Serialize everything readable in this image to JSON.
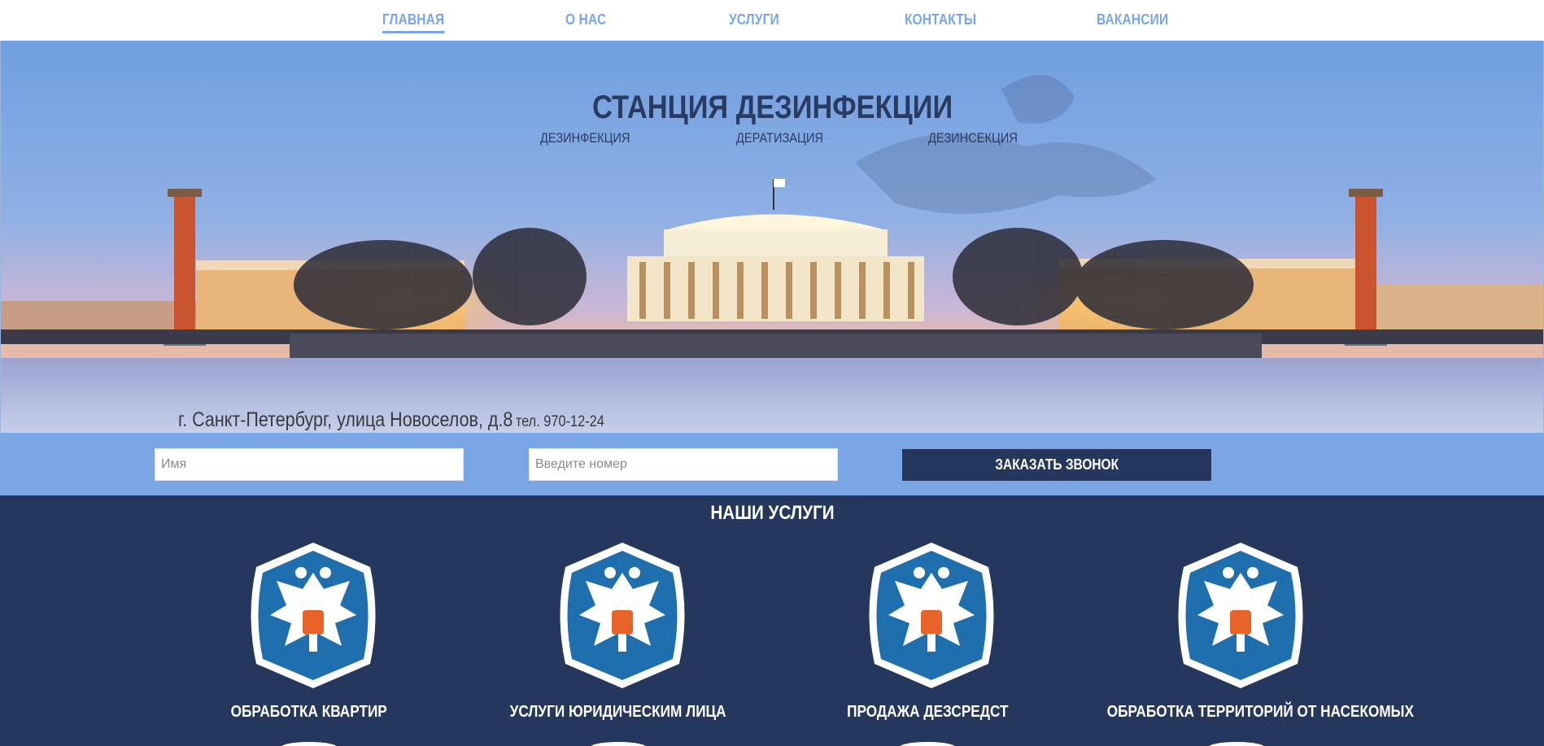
{
  "nav": {
    "items": [
      {
        "label": "ГЛАВНАЯ",
        "active": true
      },
      {
        "label": "О НАС",
        "active": false
      },
      {
        "label": "УСЛУГИ",
        "active": false
      },
      {
        "label": "КОНТАКТЫ",
        "active": false
      },
      {
        "label": "ВАКАНСИИ",
        "active": false
      }
    ]
  },
  "hero": {
    "title": "СТАНЦИЯ ДЕЗИНФЕКЦИИ",
    "subtitles": [
      "ДЕЗИНФЕКЦИЯ",
      "ДЕРАТИЗАЦИЯ",
      "ДЕЗИНСЕКЦИЯ"
    ],
    "address": "г. Санкт-Петербург, улица Новоселов, д.8",
    "phone": "тел. 970-12-24"
  },
  "form": {
    "name_placeholder": "Имя",
    "phone_placeholder": "Введите номер",
    "submit_label": "ЗАКАЗАТЬ ЗВОНОК"
  },
  "services": {
    "title": "НАШИ УСЛУГИ",
    "items": [
      {
        "label": "ОБРАБОТКА КВАРТИР",
        "icon": "coat-of-arms-icon"
      },
      {
        "label": "УСЛУГИ ЮРИДИЧЕСКИМ ЛИЦА",
        "icon": "coat-of-arms-icon"
      },
      {
        "label": "ПРОДАЖА ДЕЗСРЕДСТ",
        "icon": "coat-of-arms-icon"
      },
      {
        "label": "ОБРАБОТКА ТЕРРИТОРИЙ ОТ НАСЕКОМЫХ",
        "icon": "coat-of-arms-icon"
      }
    ]
  },
  "colors": {
    "nav_link": "#7ba6e6",
    "accent_light": "#7ba6e6",
    "accent_dark": "#26375e",
    "emblem_blue": "#1f6fae",
    "emblem_shield": "#e8632a"
  }
}
